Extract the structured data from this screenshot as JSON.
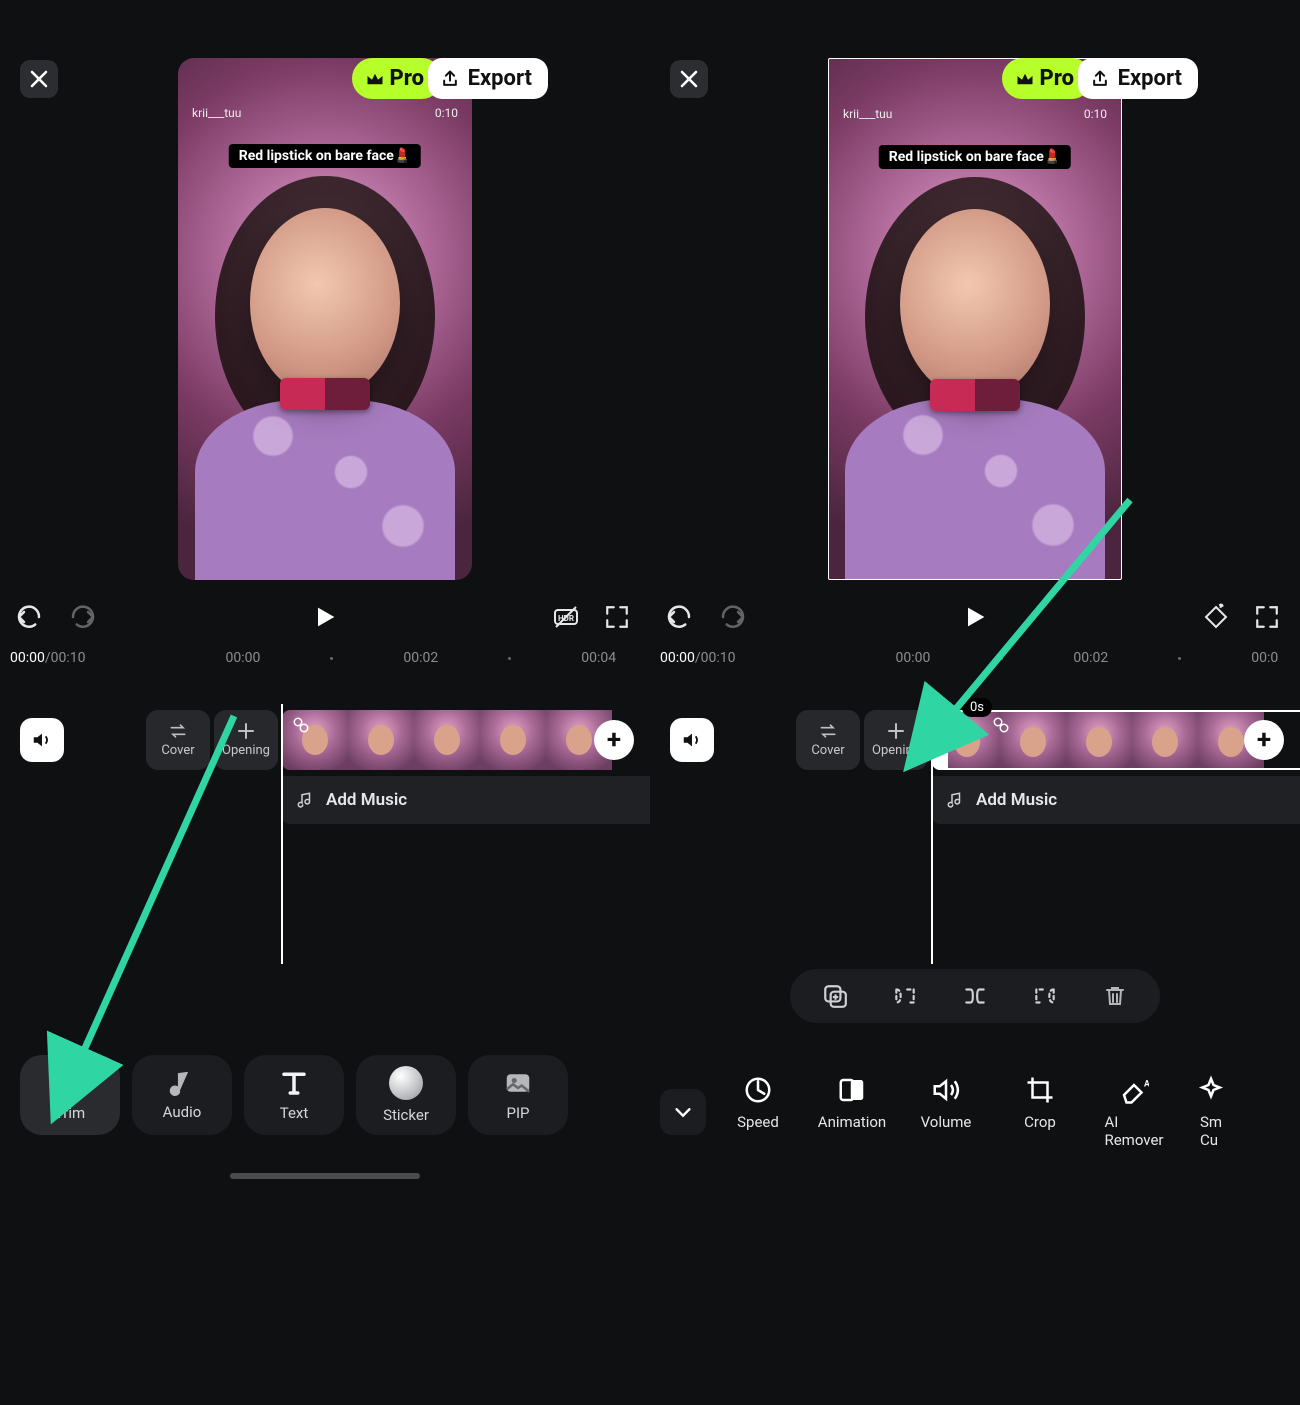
{
  "colors": {
    "accent": "#b6ff2b",
    "arrow": "#2fd6a3"
  },
  "left": {
    "pro_label": "Pro",
    "export_label": "Export",
    "preview": {
      "username": "krii___tuu",
      "clip_time": "0:10",
      "caption": "Red lipstick on bare face💄"
    },
    "time": {
      "current": "00:00",
      "total": "00:10"
    },
    "ruler": [
      "00:00",
      "00:02",
      "00:04"
    ],
    "chips": {
      "cover": "Cover",
      "opening": "Opening"
    },
    "add_music": "Add Music",
    "tools": {
      "trim": "Trim",
      "audio": "Audio",
      "text": "Text",
      "sticker": "Sticker",
      "pip": "PIP"
    }
  },
  "right": {
    "pro_label": "Pro",
    "export_label": "Export",
    "preview": {
      "username": "krii___tuu",
      "clip_time": "0:10",
      "caption": "Red lipstick on bare face💄"
    },
    "time": {
      "current": "00:00",
      "total": "00:10"
    },
    "ruler": [
      "00:00",
      "00:02",
      "00:0"
    ],
    "chips": {
      "cover": "Cover",
      "opening": "Opening"
    },
    "clip_badge": "0s",
    "add_music": "Add Music",
    "tools2": {
      "speed": "Speed",
      "animation": "Animation",
      "volume": "Volume",
      "crop": "Crop",
      "ai_remover_l1": "AI",
      "ai_remover_l2": "Remover",
      "smart_cut_l1": "Sm",
      "smart_cut_l2": "Cu"
    }
  }
}
